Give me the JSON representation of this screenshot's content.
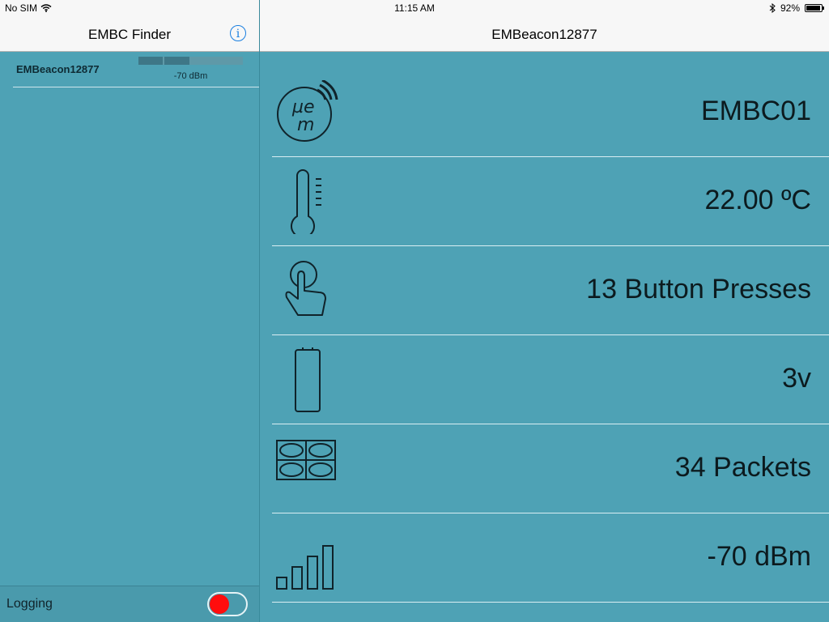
{
  "status_bar": {
    "carrier": "No SIM",
    "time": "11:15 AM",
    "battery_percent": "92%",
    "battery_level": 0.92
  },
  "left": {
    "title": "EMBC Finder",
    "info_label": "i",
    "beacons": [
      {
        "name": "EMBeacon12877",
        "rssi": "-70 dBm",
        "signal_fraction": 0.5
      }
    ],
    "logging_label": "Logging",
    "logging_on": false
  },
  "right": {
    "title": "EMBeacon12877",
    "rows": [
      {
        "icon": "em-logo-icon",
        "value": "EMBC01"
      },
      {
        "icon": "thermometer-icon",
        "value": "22.00 ºC"
      },
      {
        "icon": "finger-press-icon",
        "value": "13 Button Presses"
      },
      {
        "icon": "battery-cell-icon",
        "value": "3v"
      },
      {
        "icon": "packets-icon",
        "value": "34 Packets"
      },
      {
        "icon": "signal-bars-icon",
        "value": "-70 dBm"
      }
    ]
  }
}
